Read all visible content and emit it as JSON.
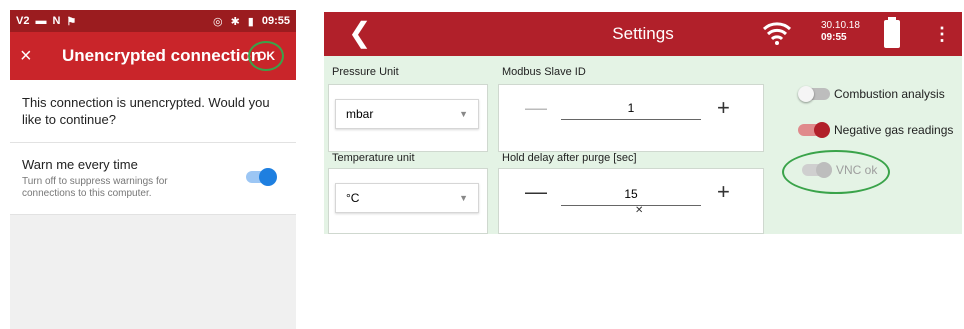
{
  "phone": {
    "status": {
      "left_text": "V2",
      "time": "09:55"
    },
    "app_bar": {
      "close": "×",
      "title": "Unencrypted connection",
      "ok": "OK"
    },
    "message": "This connection is unencrypted. Would you like to continue?",
    "warn": {
      "title": "Warn me every time",
      "subtitle": "Turn off to suppress warnings for connections to this computer.",
      "toggle_on": true
    }
  },
  "tablet": {
    "title": "Settings",
    "back": "❮",
    "date": "30.10.18",
    "time": "09:55",
    "menu": "⋮",
    "pressure": {
      "label": "Pressure Unit",
      "value": "mbar"
    },
    "temperature": {
      "label": "Temperature unit",
      "value": "°C"
    },
    "modbus": {
      "label": "Modbus Slave ID",
      "value": "1",
      "minus": "—",
      "plus": "+"
    },
    "hold": {
      "label": "Hold delay after purge [sec]",
      "value": "15",
      "minus": "—",
      "plus": "+"
    },
    "toggles": {
      "combustion": {
        "label": "Combustion analysis",
        "on": false
      },
      "negative": {
        "label": "Negative gas readings",
        "on": true
      },
      "vnc": {
        "label": "VNC ok",
        "on": true,
        "disabled": true
      }
    },
    "colors": {
      "header": "#b1202a",
      "accent_green": "#3aa34a",
      "background": "#e4f3e5"
    }
  }
}
